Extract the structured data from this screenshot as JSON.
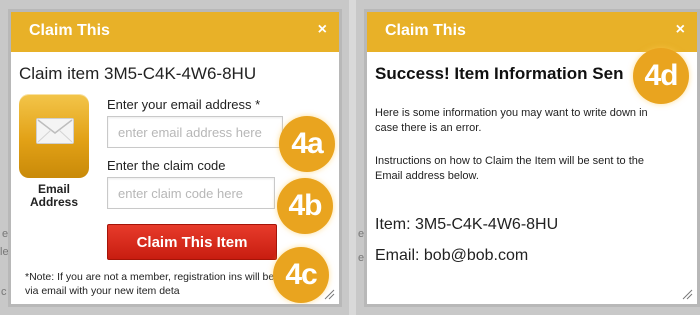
{
  "claim_modal": {
    "title": "Claim This",
    "close_label": "×",
    "heading": "Claim item 3M5-C4K-4W6-8HU",
    "email_tile": {
      "icon": "envelope-icon",
      "caption": "Email Address"
    },
    "email_field": {
      "label": "Enter your email address *",
      "placeholder": "enter email address here",
      "value": ""
    },
    "code_field": {
      "label": "Enter the claim code",
      "placeholder": "enter claim code here",
      "value": ""
    },
    "submit_label": "Claim This Item",
    "note": "*Note: If you are not a member, registration ins will be included via email with your new item deta"
  },
  "success_modal": {
    "title": "Claim This",
    "close_label": "×",
    "heading": "Success! Item Information Sen",
    "info_1": "Here is some information you may want to write down in case there is an error.",
    "info_2": "Instructions on how to Claim the Item will be sent to the Email address below.",
    "item_line": "Item: 3M5-C4K-4W6-8HU",
    "email_line": "Email: bob@bob.com"
  },
  "step_badges": {
    "a": "4a",
    "b": "4b",
    "c": "4c",
    "d": "4d"
  },
  "background_fragments": {
    "left_1": "e",
    "left_2": "le",
    "left_3": "c",
    "right_1": "e",
    "right_2": "e"
  },
  "colors": {
    "header": "#e8b128",
    "button": "#d42a1b",
    "badge": "#e9a41f",
    "panel_gray": "#c8c8c8"
  }
}
